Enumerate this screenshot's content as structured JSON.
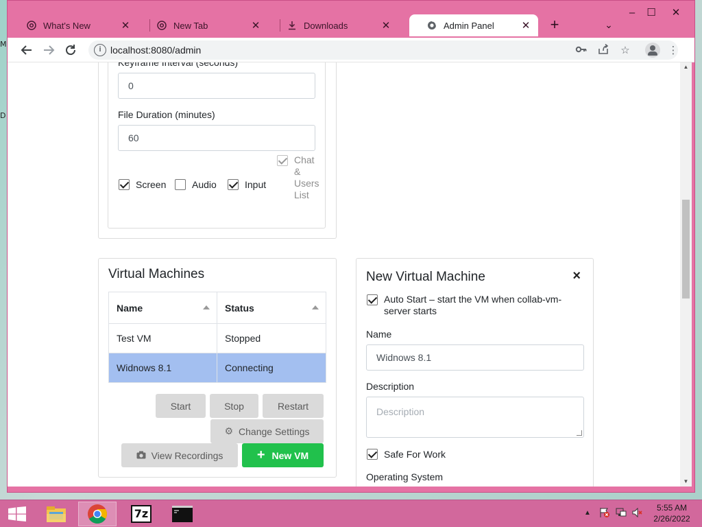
{
  "desktop": {
    "edge_label_1": "M",
    "edge_label_2": "D"
  },
  "browser": {
    "tabs": [
      {
        "label": "What's New",
        "icon": "chrome-icon"
      },
      {
        "label": "New Tab",
        "icon": "chrome-icon"
      },
      {
        "label": "Downloads",
        "icon": "download-icon"
      },
      {
        "label": "Admin Panel",
        "icon": "globe-icon",
        "active": true
      }
    ],
    "url": "localhost:8080/admin",
    "window_controls": {
      "minimize": "–",
      "maximize": "☐",
      "close": "✕"
    }
  },
  "recording_settings": {
    "keyframe_label": "Keyframe Interval (seconds)",
    "keyframe_value": "0",
    "file_duration_label": "File Duration (minutes)",
    "file_duration_value": "60",
    "options": [
      {
        "label": "Screen",
        "checked": true
      },
      {
        "label": "Audio",
        "checked": false
      },
      {
        "label": "Input",
        "checked": true
      },
      {
        "label": "Chat & Users List",
        "lines": [
          "Chat",
          "&",
          "Users",
          "List"
        ],
        "checked": true,
        "disabled": true
      }
    ]
  },
  "virtual_machines": {
    "title": "Virtual Machines",
    "columns": [
      "Name",
      "Status"
    ],
    "rows": [
      {
        "name": "Test VM",
        "status": "Stopped",
        "selected": false
      },
      {
        "name": "Widnows 8.1",
        "status": "Connecting",
        "selected": true
      }
    ],
    "buttons": {
      "start": "Start",
      "stop": "Stop",
      "restart": "Restart",
      "change_settings": "Change Settings",
      "view_recordings": "View Recordings",
      "new_vm": "New VM"
    }
  },
  "new_vm_form": {
    "title": "New Virtual Machine",
    "close": "×",
    "auto_start_label": "Auto Start – start the VM when collab-vm-server starts",
    "auto_start_line1": "Auto Start – start the VM when collab-vm-",
    "auto_start_line2": "server starts",
    "auto_start_checked": true,
    "name_label": "Name",
    "name_value": "Widnows 8.1",
    "description_label": "Description",
    "description_placeholder": "Description",
    "safe_for_work_label": "Safe For Work",
    "safe_for_work_checked": true,
    "os_label": "Operating System"
  },
  "taskbar": {
    "apps": [
      "file-explorer-icon",
      "chrome-icon",
      "7zip-icon",
      "command-prompt-icon"
    ],
    "sevenzip_text": "7z",
    "time": "5:55 AM",
    "date": "2/26/2022"
  },
  "colors": {
    "window_frame": "#e572a4",
    "taskbar": "#d2689c",
    "selected_row": "#a3bff0",
    "new_vm_button": "#21c14c"
  }
}
